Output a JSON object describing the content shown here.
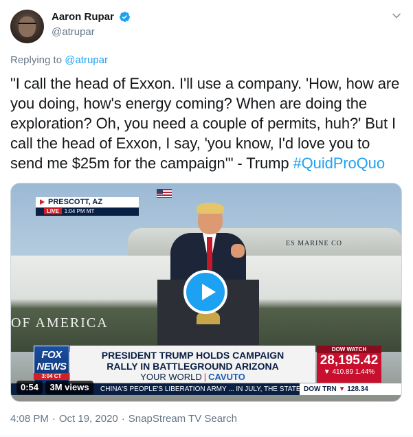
{
  "author": {
    "display_name": "Aaron Rupar",
    "handle": "@atrupar",
    "verified": true,
    "avatar_icon": "avatar-photo"
  },
  "reply": {
    "prefix": "Replying to",
    "target": "@atrupar"
  },
  "tweet": {
    "text": "\"I call the head of Exxon. I'll use a company. 'How, how are you doing, how's energy coming? When are doing the exploration? Oh, you need a couple of permits, huh?' But I call the head of Exxon, I say, 'you know, I'd love you to send me $25m for the campaign'\" - Trump ",
    "hashtag": "#QuidProQuo"
  },
  "video": {
    "duration": "0:54",
    "views": "3M views",
    "location_bug": {
      "location": "PRESCOTT, AZ",
      "live": "LIVE",
      "time": "1:04 PM MT"
    },
    "network": {
      "fox": "FOX",
      "news": "NEWS",
      "time": "3:04 CT"
    },
    "headline_line1": "PRESIDENT TRUMP HOLDS CAMPAIGN",
    "headline_line2": "RALLY IN BATTLEGROUND ARIZONA",
    "show_name": "YOUR WORLD",
    "show_separator": "|",
    "show_host": "CAVUTO",
    "dow": {
      "label": "DOW WATCH",
      "value": "28,195.42",
      "change": "▼ 410.89",
      "change_pct": "1.44%"
    },
    "ticker": {
      "text": "CHINA'S PEOPLE'S LIBERATION ARMY ... IN JULY, THE STATE DE",
      "dow_label": "DOW TRN",
      "dow_arrow": "▼",
      "dow_value": "128.34"
    },
    "scene_text_marine": "ES MARINE CO",
    "scene_text_america": "OF AMERICA"
  },
  "meta": {
    "time": "4:08 PM",
    "date": "Oct 19, 2020",
    "separator": "·",
    "source": "SnapStream TV Search"
  },
  "colors": {
    "accent": "#1da1f2",
    "secondary_text": "#657786",
    "primary_text": "#14171a"
  }
}
